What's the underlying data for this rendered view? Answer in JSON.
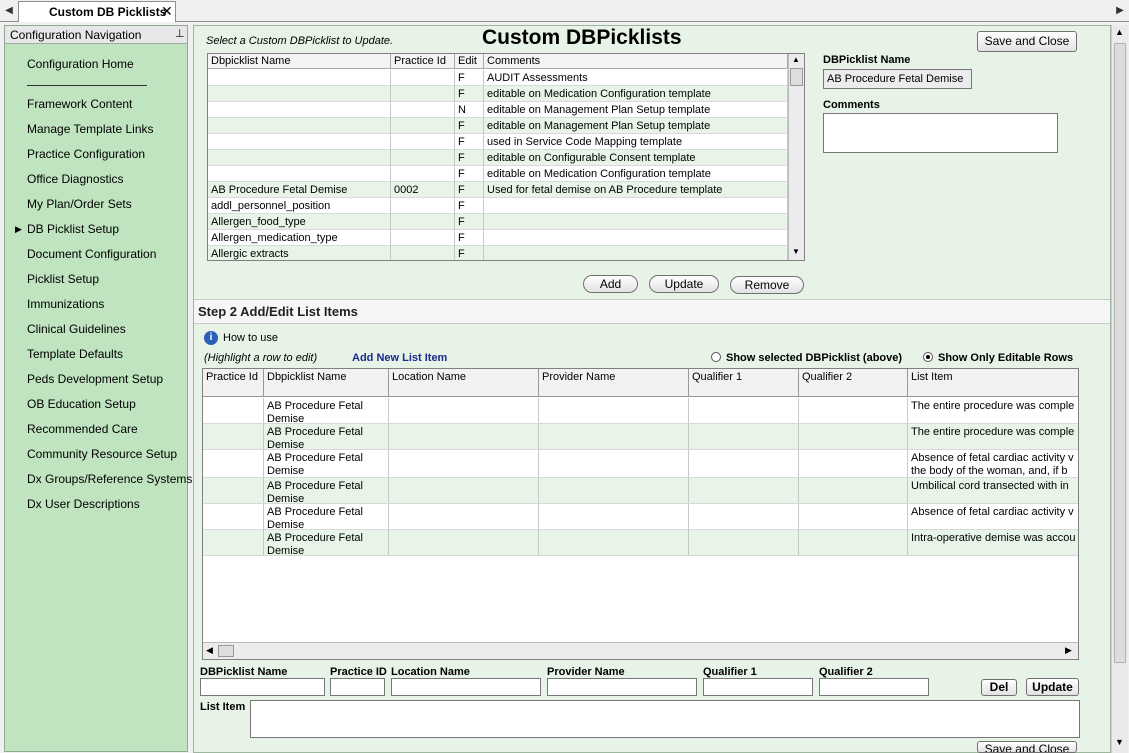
{
  "tab": {
    "title": "Custom DB Picklists",
    "close_glyph": "✕",
    "left_arrow": "◀",
    "right_arrow": "▶"
  },
  "nav": {
    "title": "Configuration Navigation",
    "pin_glyph": "📌",
    "home": "Configuration Home",
    "items": [
      "Framework Content",
      "Manage Template Links",
      "Practice Configuration",
      "Office Diagnostics",
      "My Plan/Order Sets",
      "DB Picklist Setup",
      "Document Configuration",
      "Picklist Setup",
      "Immunizations",
      "Clinical Guidelines",
      "Template Defaults",
      "Peds Development Setup",
      "OB Education Setup",
      "Recommended Care",
      "Community Resource Setup",
      "Dx Groups/Reference Systems",
      "Dx User Descriptions"
    ],
    "selected_index": 5,
    "pointer_glyph": "▶"
  },
  "page": {
    "instruction": "Select a Custom DBPicklist to Update.",
    "title": "Custom DBPicklists",
    "save_close_label": "Save and Close",
    "detail": {
      "name_label": "DBPicklist Name",
      "name_value": "AB Procedure Fetal Demise",
      "comments_label": "Comments",
      "comments_value": ""
    }
  },
  "picklist_grid": {
    "columns": [
      "Dbpicklist Name",
      "Practice Id",
      "Edit",
      "Comments"
    ],
    "rows": [
      {
        "name": "",
        "practice_id": "",
        "edit": "F",
        "comments": "AUDIT Assessments"
      },
      {
        "name": "",
        "practice_id": "",
        "edit": "F",
        "comments": "editable on Medication Configuration template"
      },
      {
        "name": "",
        "practice_id": "",
        "edit": "N",
        "comments": "editable on  Management Plan Setup template"
      },
      {
        "name": "",
        "practice_id": "",
        "edit": "F",
        "comments": "editable on Management Plan Setup template"
      },
      {
        "name": "",
        "practice_id": "",
        "edit": "F",
        "comments": "used in Service Code Mapping template"
      },
      {
        "name": "",
        "practice_id": "",
        "edit": "F",
        "comments": "editable on Configurable Consent template"
      },
      {
        "name": "",
        "practice_id": "",
        "edit": "F",
        "comments": "editable on Medication Configuration template"
      },
      {
        "name": "AB Procedure Fetal Demise",
        "practice_id": "0002",
        "edit": "F",
        "comments": "Used for fetal demise on AB Procedure template"
      },
      {
        "name": "addl_personnel_position",
        "practice_id": "",
        "edit": "F",
        "comments": ""
      },
      {
        "name": "Allergen_food_type",
        "practice_id": "",
        "edit": "F",
        "comments": ""
      },
      {
        "name": "Allergen_medication_type",
        "practice_id": "",
        "edit": "F",
        "comments": ""
      },
      {
        "name": "Allergic extracts",
        "practice_id": "",
        "edit": "F",
        "comments": ""
      }
    ],
    "scroll_up": "▲",
    "scroll_down": "▼"
  },
  "actions": {
    "add": "Add",
    "update": "Update",
    "remove": "Remove"
  },
  "step2": {
    "title": "Step 2 Add/Edit List Items",
    "info_glyph": "i",
    "how_to_use": "How to use",
    "hint": "(Highlight a row to edit)",
    "add_new": "Add New List Item",
    "radio_selected": "Show selected DBPicklist (above)",
    "radio_editable": "Show Only Editable Rows",
    "radio_checked": "editable"
  },
  "list_grid": {
    "columns": [
      "Practice Id",
      "Dbpicklist Name",
      "Location Name",
      "Provider Name",
      "Qualifier 1",
      "Qualifier 2",
      "List Item"
    ],
    "rows": [
      {
        "practice_id": "",
        "name": "AB Procedure Fetal Demise",
        "location": "",
        "provider": "",
        "q1": "",
        "q2": "",
        "item": "The entire procedure was comple"
      },
      {
        "practice_id": "",
        "name": "AB Procedure Fetal Demise",
        "location": "",
        "provider": "",
        "q1": "",
        "q2": "",
        "item": "The entire procedure was comple"
      },
      {
        "practice_id": "",
        "name": "AB Procedure Fetal Demise",
        "location": "",
        "provider": "",
        "q1": "",
        "q2": "",
        "item": "Absence of fetal cardiac activity v the body of the woman, and, if b"
      },
      {
        "practice_id": "",
        "name": "AB Procedure Fetal Demise",
        "location": "",
        "provider": "",
        "q1": "",
        "q2": "",
        "item": "Umbilical cord transected with in"
      },
      {
        "practice_id": "",
        "name": "AB Procedure Fetal Demise",
        "location": "",
        "provider": "",
        "q1": "",
        "q2": "",
        "item": "Absence of fetal cardiac activity v"
      },
      {
        "practice_id": "",
        "name": "AB Procedure Fetal Demise",
        "location": "",
        "provider": "",
        "q1": "",
        "q2": "",
        "item": "Intra-operative demise was accou"
      }
    ],
    "scroll_left": "◀",
    "scroll_right": "▶"
  },
  "edit_form": {
    "name_label": "DBPicklist Name",
    "practice_label": "Practice ID",
    "location_label": "Location Name",
    "provider_label": "Provider Name",
    "q1_label": "Qualifier 1",
    "q2_label": "Qualifier 2",
    "list_item_label": "List Item",
    "del_label": "Del",
    "update_label": "Update",
    "name_value": "",
    "practice_value": "",
    "location_value": "",
    "provider_value": "",
    "q1_value": "",
    "q2_value": "",
    "list_item_value": "",
    "bottom_save_close": "Save and Close"
  },
  "window_scroll": {
    "up": "▲",
    "down": "▼"
  }
}
